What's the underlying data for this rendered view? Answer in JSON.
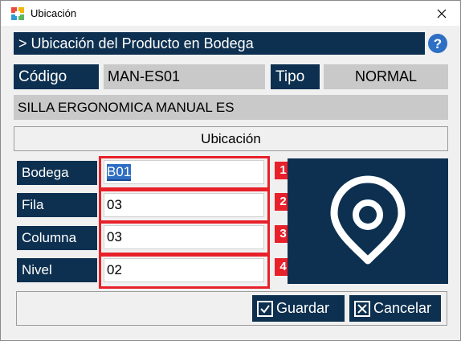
{
  "window": {
    "title": "Ubicación",
    "close_glyph": "✕"
  },
  "header": {
    "title": "> Ubicación del Producto en Bodega",
    "help_glyph": "?"
  },
  "product": {
    "codigo_label": "Código",
    "codigo_value": "MAN-ES01",
    "tipo_label": "Tipo",
    "tipo_value": "NORMAL",
    "descripcion": "SILLA ERGONOMICA MANUAL ES"
  },
  "section": {
    "title": "Ubicación"
  },
  "fields": [
    {
      "label": "Bodega",
      "value": "B01",
      "badge": "1"
    },
    {
      "label": "Fila",
      "value": "03",
      "badge": "2"
    },
    {
      "label": "Columna",
      "value": "03",
      "badge": "3"
    },
    {
      "label": "Nivel",
      "value": "02",
      "badge": "4"
    }
  ],
  "buttons": {
    "save": "Guardar",
    "cancel": "Cancelar"
  },
  "colors": {
    "navy": "#0d3050",
    "annotation_red": "#e8202a",
    "gray": "#c9c9c9",
    "help_blue": "#2d6fc4"
  },
  "icons": {
    "app": "app-logo-icon",
    "location": "location-pin-icon",
    "save": "check-box-icon",
    "cancel": "x-box-icon"
  }
}
